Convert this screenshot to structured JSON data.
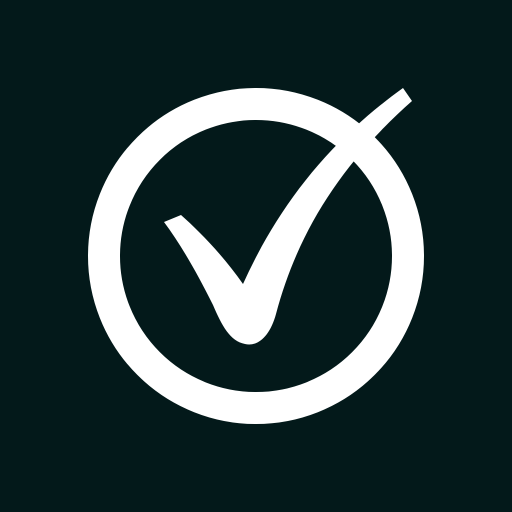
{
  "icon": {
    "name": "circle-check-icon",
    "background_color": "#03191a",
    "foreground_color": "#ffffff"
  }
}
